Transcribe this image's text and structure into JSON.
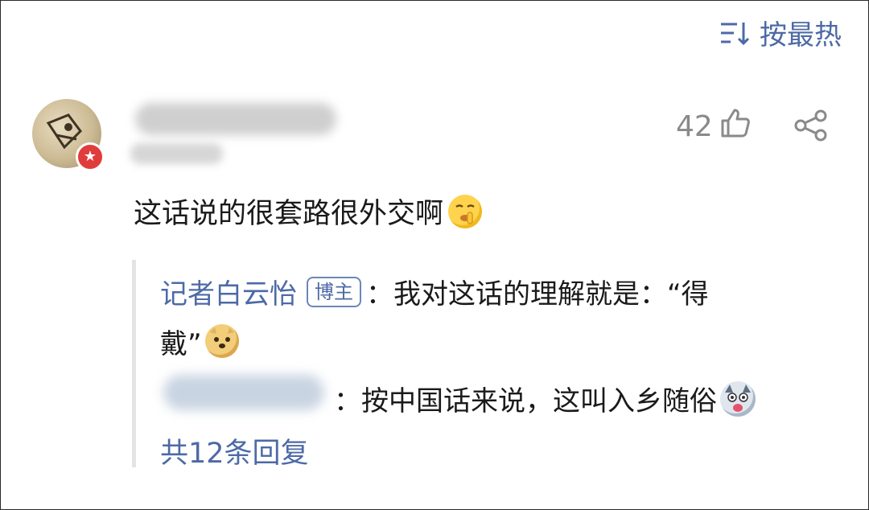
{
  "sort": {
    "label": "按最热"
  },
  "comment": {
    "author_badge_icon": "verified-star-icon",
    "like_count": "42",
    "text": "这话说的很套路很外交啊",
    "emoji": "shush-emoji"
  },
  "replies": [
    {
      "author": "记者白云怡",
      "tag": "博主",
      "text_line1": "：我对这话的理解就是：“得",
      "text_line2": "戴”",
      "emoji": "doge-emoji"
    },
    {
      "text": "：按中国话来说，这叫入乡随俗",
      "emoji": "husky-emoji"
    }
  ],
  "more_replies": "共12条回复",
  "colors": {
    "link": "#4d6aa6",
    "badge": "#e03c3c",
    "muted": "#8a8a8a"
  }
}
